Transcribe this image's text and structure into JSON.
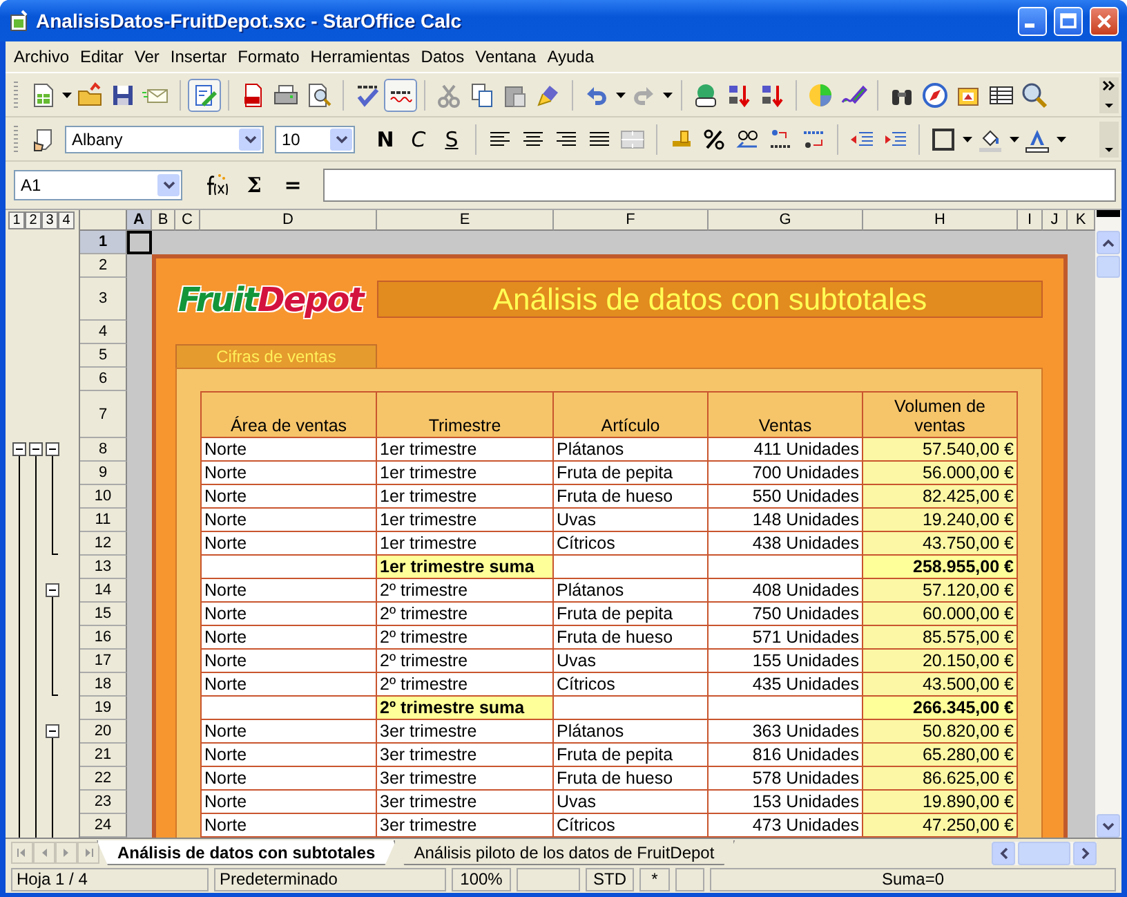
{
  "window": {
    "title": "AnalisisDatos-FruitDepot.sxc - StarOffice Calc"
  },
  "menu": [
    "Archivo",
    "Editar",
    "Ver",
    "Insertar",
    "Formato",
    "Herramientas",
    "Datos",
    "Ventana",
    "Ayuda"
  ],
  "toolbar_toggles": {
    "edit_mode": true,
    "auto_spellcheck": true
  },
  "format_toolbar": {
    "font": "Albany",
    "size": "10",
    "styles": [
      "N",
      "C",
      "S"
    ]
  },
  "formula_bar": {
    "cell_reference": "A1",
    "function_buttons": [
      "Σ",
      "="
    ]
  },
  "outline_levels": [
    "1",
    "2",
    "3",
    "4"
  ],
  "columns": [
    {
      "label": "A",
      "selected": true
    },
    {
      "label": "B",
      "selected": false
    },
    {
      "label": "C",
      "selected": false
    },
    {
      "label": "D",
      "selected": false
    },
    {
      "label": "E",
      "selected": false
    },
    {
      "label": "F",
      "selected": false
    },
    {
      "label": "G",
      "selected": false
    },
    {
      "label": "H",
      "selected": false
    },
    {
      "label": "I",
      "selected": false
    },
    {
      "label": "J",
      "selected": false
    },
    {
      "label": "K",
      "selected": false
    }
  ],
  "rows": [
    {
      "label": "1",
      "selected": true
    },
    {
      "label": "2",
      "selected": false
    },
    {
      "label": "3",
      "selected": false
    },
    {
      "label": "4",
      "selected": false
    },
    {
      "label": "5",
      "selected": false
    },
    {
      "label": "6",
      "selected": false
    },
    {
      "label": "7",
      "selected": false
    },
    {
      "label": "8",
      "selected": false
    },
    {
      "label": "9",
      "selected": false
    },
    {
      "label": "10",
      "selected": false
    },
    {
      "label": "11",
      "selected": false
    },
    {
      "label": "12",
      "selected": false
    },
    {
      "label": "13",
      "selected": false
    },
    {
      "label": "14",
      "selected": false
    },
    {
      "label": "15",
      "selected": false
    },
    {
      "label": "16",
      "selected": false
    },
    {
      "label": "17",
      "selected": false
    },
    {
      "label": "18",
      "selected": false
    },
    {
      "label": "19",
      "selected": false
    },
    {
      "label": "20",
      "selected": false
    },
    {
      "label": "21",
      "selected": false
    },
    {
      "label": "22",
      "selected": false
    },
    {
      "label": "23",
      "selected": false
    },
    {
      "label": "24",
      "selected": false
    }
  ],
  "sheet": {
    "logo": [
      "Fruit",
      "Depot"
    ],
    "title": "Análisis de datos con subtotales",
    "section_tab": "Cifras de ventas",
    "table": {
      "columns": [
        "Área de ventas",
        "Trimestre",
        "Artículo",
        "Ventas",
        "Volumen de ventas"
      ],
      "rows": [
        {
          "kind": "data",
          "cells": [
            "Norte",
            "1er trimestre",
            "Plátanos",
            "411 Unidades",
            "57.540,00 €"
          ]
        },
        {
          "kind": "data",
          "cells": [
            "Norte",
            "1er trimestre",
            "Fruta de pepita",
            "700 Unidades",
            "56.000,00 €"
          ]
        },
        {
          "kind": "data",
          "cells": [
            "Norte",
            "1er trimestre",
            "Fruta de hueso",
            "550 Unidades",
            "82.425,00 €"
          ]
        },
        {
          "kind": "data",
          "cells": [
            "Norte",
            "1er trimestre",
            "Uvas",
            "148 Unidades",
            "19.240,00 €"
          ]
        },
        {
          "kind": "data",
          "cells": [
            "Norte",
            "1er trimestre",
            "Cítricos",
            "438 Unidades",
            "43.750,00 €"
          ]
        },
        {
          "kind": "subtotal",
          "label": "1er trimestre suma",
          "total": "258.955,00 €"
        },
        {
          "kind": "data",
          "cells": [
            "Norte",
            "2º trimestre",
            "Plátanos",
            "408 Unidades",
            "57.120,00 €"
          ]
        },
        {
          "kind": "data",
          "cells": [
            "Norte",
            "2º trimestre",
            "Fruta de pepita",
            "750 Unidades",
            "60.000,00 €"
          ]
        },
        {
          "kind": "data",
          "cells": [
            "Norte",
            "2º trimestre",
            "Fruta de hueso",
            "571 Unidades",
            "85.575,00 €"
          ]
        },
        {
          "kind": "data",
          "cells": [
            "Norte",
            "2º trimestre",
            "Uvas",
            "155 Unidades",
            "20.150,00 €"
          ]
        },
        {
          "kind": "data",
          "cells": [
            "Norte",
            "2º trimestre",
            "Cítricos",
            "435 Unidades",
            "43.500,00 €"
          ]
        },
        {
          "kind": "subtotal",
          "label": "2º trimestre suma",
          "total": "266.345,00 €"
        },
        {
          "kind": "data",
          "cells": [
            "Norte",
            "3er trimestre",
            "Plátanos",
            "363 Unidades",
            "50.820,00 €"
          ]
        },
        {
          "kind": "data",
          "cells": [
            "Norte",
            "3er trimestre",
            "Fruta de pepita",
            "816 Unidades",
            "65.280,00 €"
          ]
        },
        {
          "kind": "data",
          "cells": [
            "Norte",
            "3er trimestre",
            "Fruta de hueso",
            "578 Unidades",
            "86.625,00 €"
          ]
        },
        {
          "kind": "data",
          "cells": [
            "Norte",
            "3er trimestre",
            "Uvas",
            "153 Unidades",
            "19.890,00 €"
          ]
        },
        {
          "kind": "data",
          "cells": [
            "Norte",
            "3er trimestre",
            "Cítricos",
            "473 Unidades",
            "47.250,00 €"
          ]
        }
      ]
    }
  },
  "sheet_tabs": [
    {
      "label": "Análisis de datos con subtotales",
      "selected": true
    },
    {
      "label": "Análisis piloto de los datos de FruitDepot",
      "selected": false
    }
  ],
  "status_bar": {
    "sheet": "Hoja 1 / 4",
    "page_style": "Predeterminado",
    "zoom": "100%",
    "mode": "STD",
    "modified": "*",
    "sum": "Suma=0"
  }
}
